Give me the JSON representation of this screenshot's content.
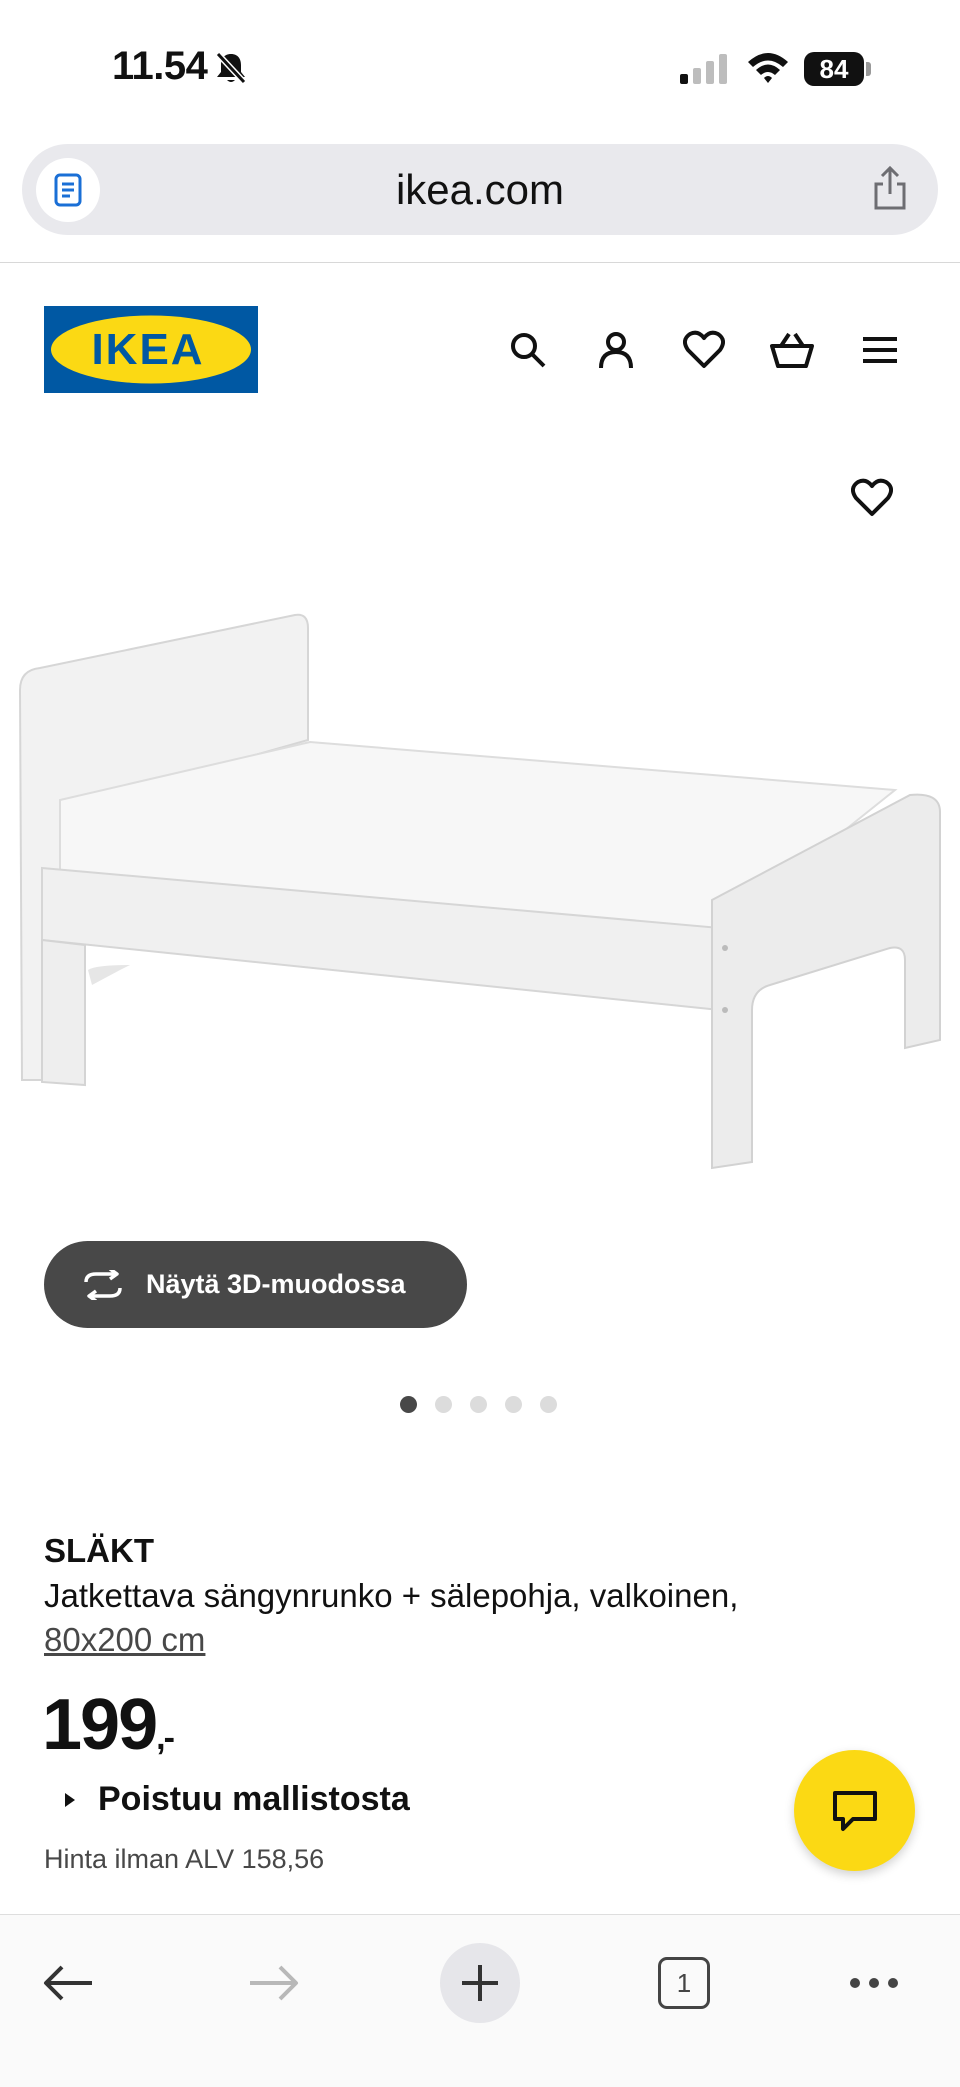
{
  "status_bar": {
    "time": "11.54",
    "battery": "84"
  },
  "browser": {
    "url": "ikea.com"
  },
  "brand": {
    "logo_text": "IKEA",
    "logo_bg": "#0058a3",
    "logo_fg": "#fbd914"
  },
  "header_icons": [
    "search-icon",
    "account-icon",
    "heart-icon",
    "basket-icon",
    "menu-icon"
  ],
  "product": {
    "view_3d_label": "Näytä 3D-muodossa",
    "image_count": 5,
    "active_image": 1,
    "name": "SLÄKT",
    "description": "Jatkettava sängynrunko + sälepohja, valkoinen,",
    "size": "80x200 cm",
    "price": "199",
    "price_suffix": ",-",
    "availability": "Poistuu mallistosta",
    "vat_price": "Hinta ilman ALV 158,56"
  },
  "chat": {
    "color": "#fbd914"
  },
  "toolbar": {
    "tab_count": "1"
  }
}
